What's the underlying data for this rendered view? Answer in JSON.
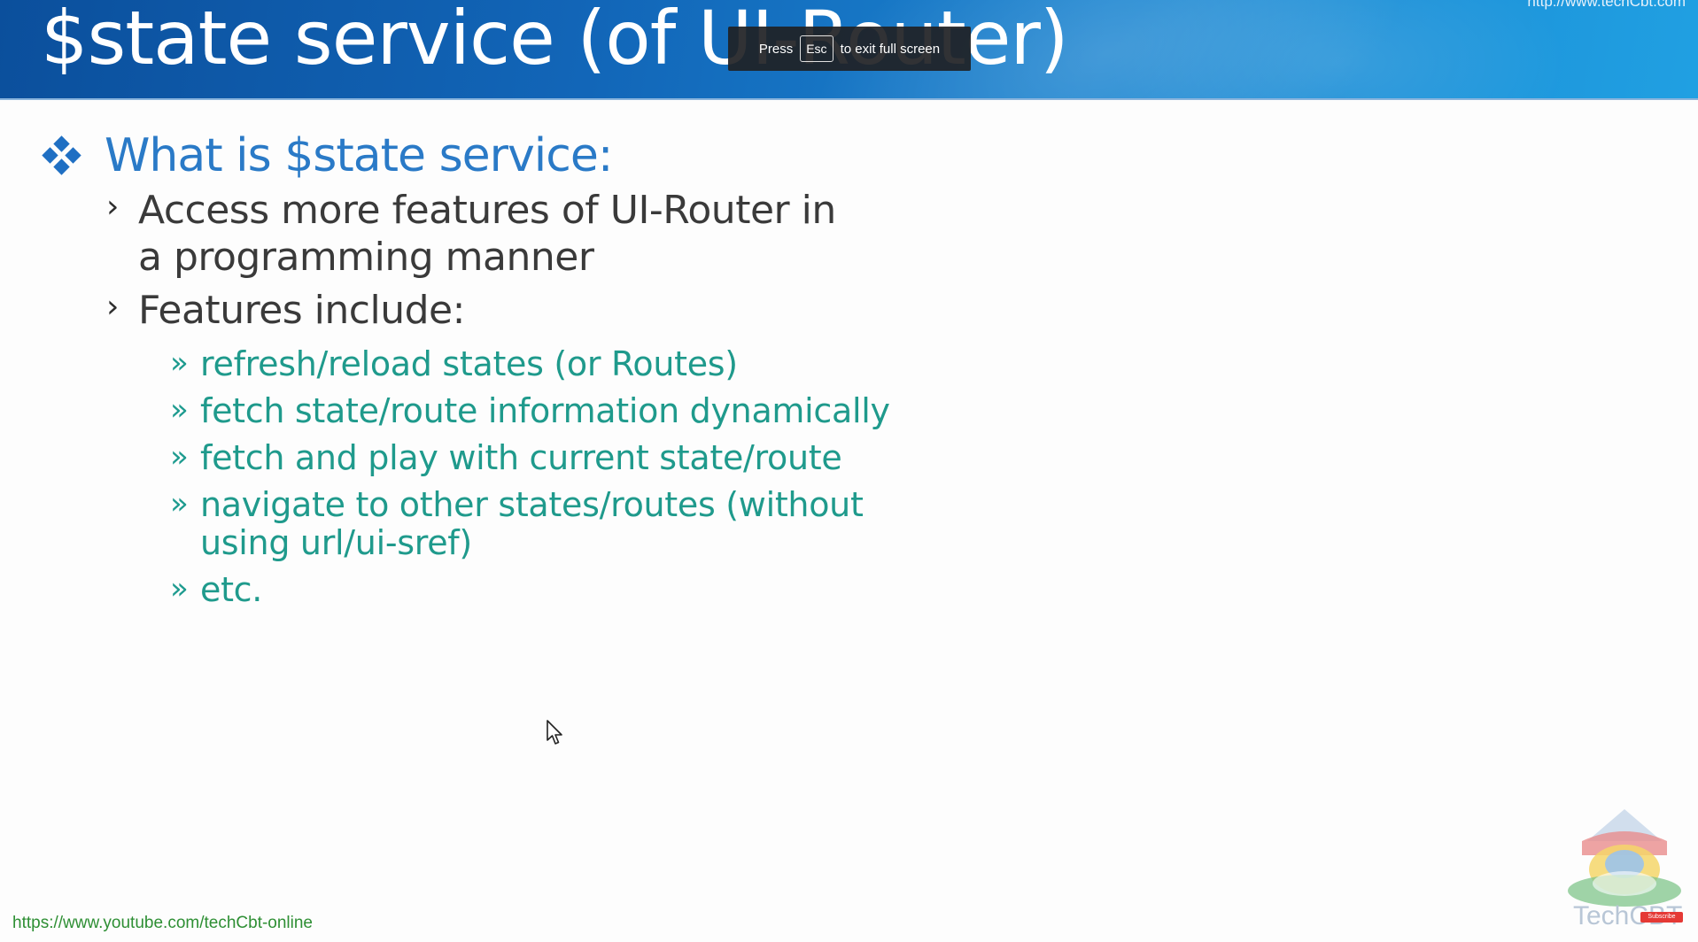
{
  "header": {
    "title": "$state service (of UI-Router)",
    "url": "http://www.techCbt.com"
  },
  "fullscreen_toast": {
    "press": "Press",
    "key": "Esc",
    "suffix": "to exit full screen"
  },
  "body": {
    "heading": "What is $state service:",
    "points": [
      {
        "text": "Access more features of UI-Router in a programming manner"
      },
      {
        "text": "Features include:",
        "subpoints": [
          "refresh/reload states (or Routes)",
          "fetch state/route information dynamically",
          "fetch and play with current state/route",
          "navigate to other states/routes (without using url/ui-sref)",
          "etc."
        ]
      }
    ]
  },
  "footer": {
    "link": "https://www.youtube.com/techCbt-online"
  },
  "logo": {
    "text": "TechCBT",
    "badge": "Subscribe"
  },
  "colors": {
    "header_blue": "#1266b8",
    "heading_blue": "#2a7ac7",
    "sub_teal": "#1f9a8c",
    "footer_green": "#2e8f34"
  }
}
